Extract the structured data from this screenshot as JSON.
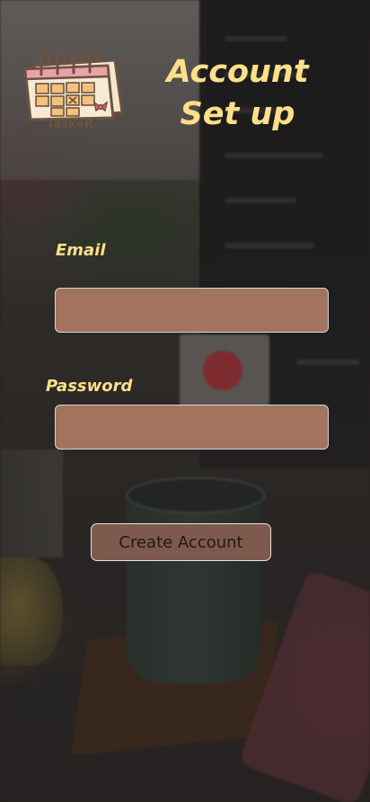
{
  "app": {
    "logo_text": "TaskeR",
    "logo_icon": "calendar-icon"
  },
  "header": {
    "title_line1": "Account",
    "title_line2": "Set up"
  },
  "form": {
    "email_label": "Email",
    "email_value": "",
    "password_label": "Password",
    "password_value": "",
    "submit_label": "Create Account"
  },
  "colors": {
    "accent_text": "#ffe08a",
    "input_fill": "#a3735d",
    "button_fill": "#7d5a4d"
  }
}
